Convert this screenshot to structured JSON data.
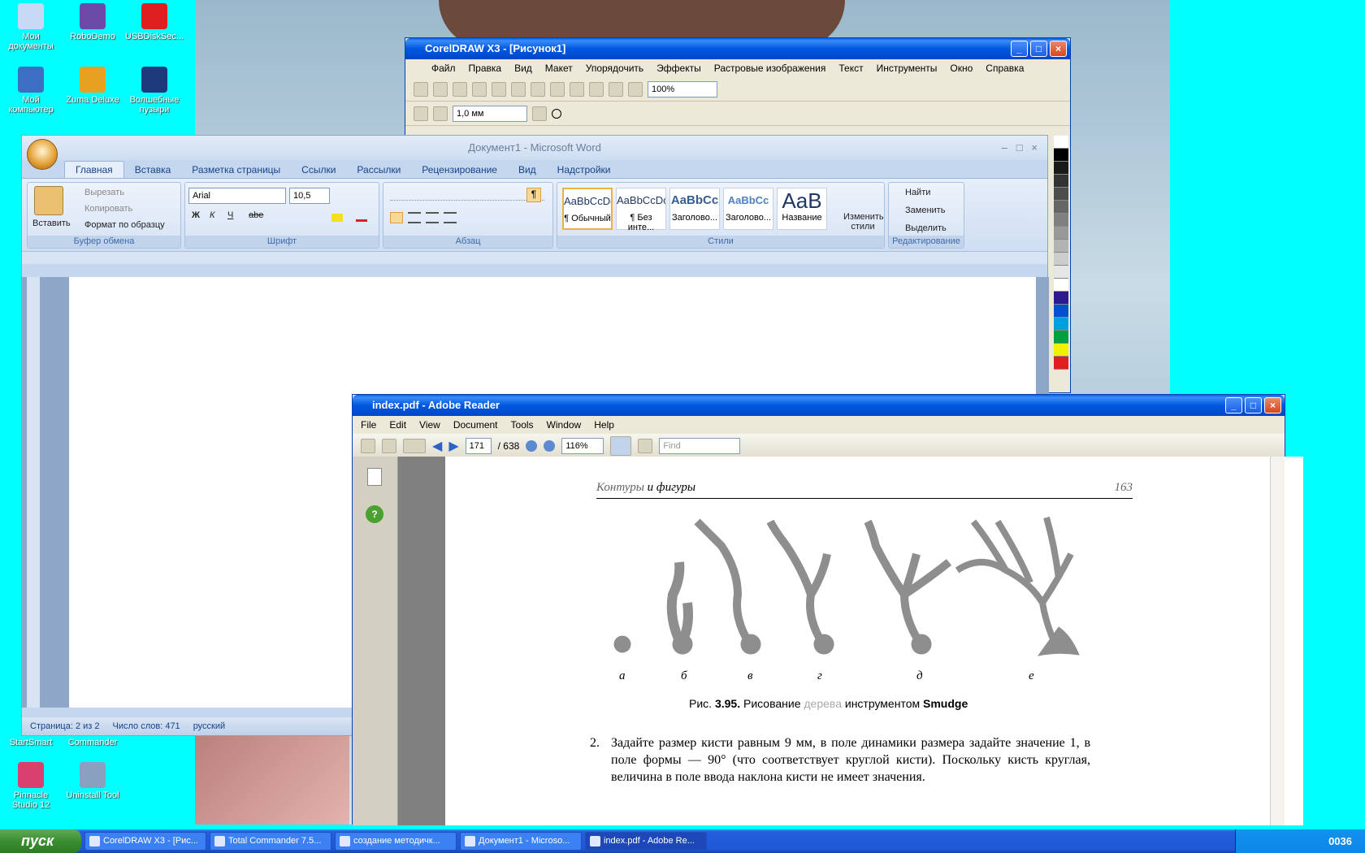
{
  "desktop": {
    "icons_left": [
      {
        "label": "Мои документы"
      },
      {
        "label": "RoboDemo"
      },
      {
        "label": "USBDiskSec..."
      },
      {
        "label": "Мой компьютер"
      },
      {
        "label": "Zuma Deluxe"
      },
      {
        "label": "Волшебные пузыри"
      },
      {
        "label": "StartSmart"
      },
      {
        "label": "Commander"
      },
      {
        "label": "Pinnacle Studio 12"
      },
      {
        "label": "Uninstall Tool"
      }
    ]
  },
  "corel": {
    "title": "CorelDRAW X3 - [Рисунок1]",
    "menu": [
      "Файл",
      "Правка",
      "Вид",
      "Макет",
      "Упорядочить",
      "Эффекты",
      "Растровые изображения",
      "Текст",
      "Инструменты",
      "Окно",
      "Справка"
    ],
    "zoom": "100%",
    "outline_width": "1,0 мм"
  },
  "word": {
    "title": "Документ1 - Microsoft Word",
    "tabs": [
      "Главная",
      "Вставка",
      "Разметка страницы",
      "Ссылки",
      "Рассылки",
      "Рецензирование",
      "Вид",
      "Надстройки"
    ],
    "clipboard": {
      "paste": "Вставить",
      "cut": "Вырезать",
      "copy": "Копировать",
      "format_painter": "Формат по образцу",
      "label": "Буфер обмена"
    },
    "font": {
      "name": "Arial",
      "size": "10,5",
      "label": "Шрифт",
      "bold": "Ж",
      "italic": "К",
      "underline": "Ч",
      "strike": "abe"
    },
    "paragraph": {
      "label": "Абзац"
    },
    "styles": {
      "label": "Стили",
      "items": [
        {
          "sample": "AaBbCcDc",
          "name": "¶ Обычный"
        },
        {
          "sample": "AaBbCcDc",
          "name": "¶ Без инте..."
        },
        {
          "sample": "AaBbCc",
          "name": "Заголово..."
        },
        {
          "sample": "AaBbCc",
          "name": "Заголово..."
        },
        {
          "sample": "AaB",
          "name": "Название"
        }
      ],
      "change": "Изменить стили"
    },
    "editing": {
      "label": "Редактирование",
      "find": "Найти",
      "replace": "Заменить",
      "select": "Выделить"
    },
    "status": {
      "page": "Страница: 2 из 2",
      "words": "Число слов: 471",
      "lang": "русский"
    }
  },
  "reader": {
    "title": "index.pdf - Adobe Reader",
    "menu": [
      "File",
      "Edit",
      "View",
      "Document",
      "Tools",
      "Window",
      "Help"
    ],
    "page_current": "171",
    "page_total": "/ 638",
    "zoom": "116%",
    "find_placeholder": "Find",
    "pdf": {
      "header_left": "Контуры",
      "header_mid": "и фигуры",
      "header_right": "163",
      "labels": [
        "а",
        "б",
        "в",
        "г",
        "д",
        "е"
      ],
      "caption_prefix": "Рис.",
      "caption_num": "3.95.",
      "caption_text": "Рисование",
      "caption_word2": "дерева",
      "caption_text2": "инструментом",
      "caption_tool": "Smudge",
      "para_num": "2.",
      "para_text": "Задайте размер кисти равным 9 мм, в поле динамики размера задайте значение 1, в поле формы — 90° (что соответствует круглой кисти). Поскольку кисть круглая, величина в поле ввода наклона кисти не имеет значения."
    }
  },
  "taskbar": {
    "start": "пуск",
    "tasks": [
      "CorelDRAW X3 - [Рис...",
      "Total Commander 7.5...",
      "создание методичк...",
      "Документ1 - Microso...",
      "index.pdf - Adobe Re..."
    ],
    "clock": "0036"
  }
}
